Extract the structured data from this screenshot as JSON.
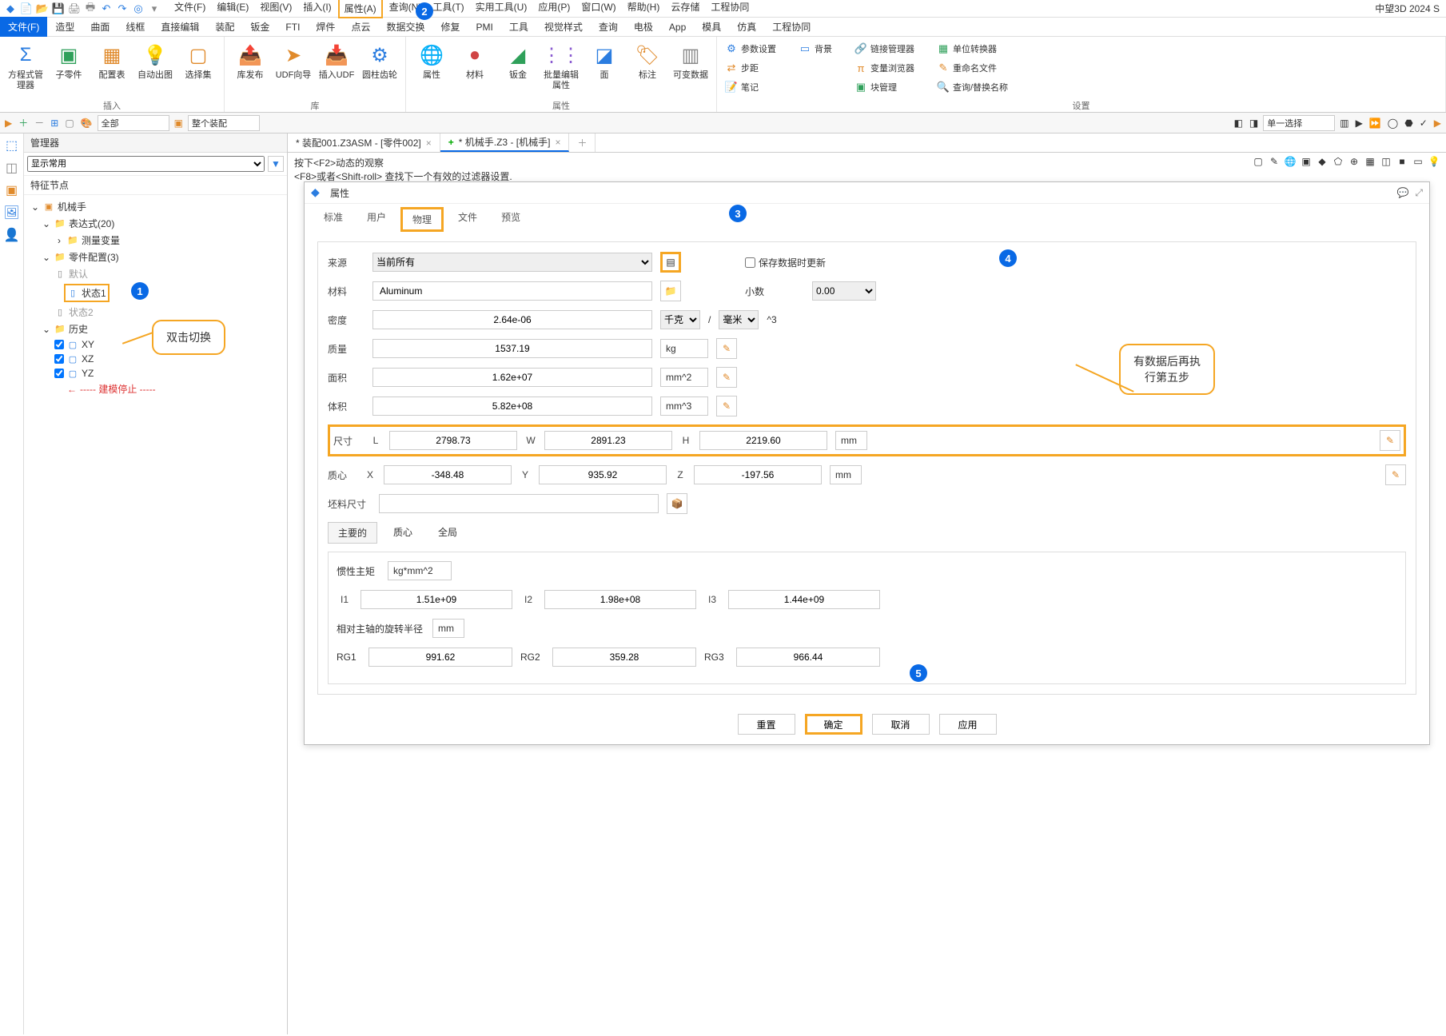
{
  "brand": "中望3D 2024 S",
  "menus": [
    "文件(F)",
    "编辑(E)",
    "视图(V)",
    "插入(I)",
    "属性(A)",
    "查询(N)",
    "工具(T)",
    "实用工具(U)",
    "应用(P)",
    "窗口(W)",
    "帮助(H)",
    "云存储",
    "工程协同"
  ],
  "menu_boxed_index": 4,
  "ribbon_tabs": [
    "文件(F)",
    "造型",
    "曲面",
    "线框",
    "直接编辑",
    "装配",
    "钣金",
    "FTI",
    "焊件",
    "点云",
    "数据交换",
    "修复",
    "PMI",
    "工具",
    "视觉样式",
    "查询",
    "电极",
    "App",
    "模具",
    "仿真",
    "工程协同"
  ],
  "ribbon_active": "文件(F)",
  "ribbon_groups": {
    "g1": {
      "label": "插入",
      "btns": [
        "方程式管理器",
        "子零件",
        "配置表",
        "自动出图",
        "选择集"
      ]
    },
    "g2": {
      "label": "库",
      "btns": [
        "库发布",
        "UDF向导",
        "插入UDF",
        "圆柱齿轮"
      ]
    },
    "g3": {
      "label": "属性",
      "btns": [
        "属性",
        "材料",
        "钣金",
        "批量编辑属性",
        "面",
        "标注",
        "可变数据"
      ]
    },
    "g4": {
      "label": "设置",
      "items": [
        "参数设置",
        "步距",
        "笔记",
        "背景",
        "链接管理器",
        "变量浏览器",
        "块管理",
        "单位转换器",
        "重命名文件",
        "查询/替换名称"
      ]
    }
  },
  "toolbar2": {
    "combo1": "全部",
    "combo2": "整个装配",
    "combo3": "单一选择"
  },
  "manager": {
    "title": "管理器",
    "display": "显示常用",
    "feature_label": "特征节点",
    "tree": {
      "root": "机械手",
      "expr": "表达式(20)",
      "measure": "测量变量",
      "partcfg": "零件配置(3)",
      "default": "默认",
      "state1": "状态1",
      "state2": "状态2",
      "history": "历史",
      "xy": "XY",
      "xz": "XZ",
      "yz": "YZ",
      "stop": "----- 建模停止 -----"
    }
  },
  "doc_tabs": {
    "tab1": "* 装配001.Z3ASM - [零件002]",
    "tab2": "* 机械手.Z3 - [机械手]",
    "plus": "+"
  },
  "hints": {
    "l1": "按下<F2>动态的观察",
    "l2": "<F8>或者<Shift-roll> 查找下一个有效的过滤器设置."
  },
  "dialog": {
    "title": "属性",
    "tabs": [
      "标准",
      "用户",
      "物理",
      "文件",
      "预览"
    ],
    "labels": {
      "source": "来源",
      "material": "材料",
      "density": "密度",
      "mass": "质量",
      "area": "面积",
      "volume": "体积",
      "size": "尺寸",
      "centroid": "质心",
      "blank": "坯料尺寸",
      "save_update": "保存数据时更新",
      "decimal": "小数",
      "inertia_unit_lbl": "惯性主矩",
      "rot_radius": "相对主轴的旋转半径"
    },
    "source_value": "当前所有",
    "material_value": "Aluminum",
    "density_value": "2.64e-06",
    "density_unit1": "千克",
    "density_slash": "/",
    "density_unit2": "毫米",
    "density_exp": "^3",
    "decimal_value": "0.00",
    "mass": {
      "v": "1537.19",
      "u": "kg"
    },
    "area": {
      "v": "1.62e+07",
      "u": "mm^2"
    },
    "volume": {
      "v": "5.82e+08",
      "u": "mm^3"
    },
    "size": {
      "L": "2798.73",
      "W": "2891.23",
      "H": "2219.60",
      "u": "mm"
    },
    "centroid": {
      "X": "-348.48",
      "Y": "935.92",
      "Z": "-197.56",
      "u": "mm"
    },
    "inertia_tabs": [
      "主要的",
      "质心",
      "全局"
    ],
    "inertia_unit": "kg*mm^2",
    "I1": "1.51e+09",
    "I2": "1.98e+08",
    "I3": "1.44e+09",
    "rot_unit": "mm",
    "RG1": "991.62",
    "RG2": "359.28",
    "RG3": "966.44",
    "actions": {
      "reset": "重置",
      "ok": "确定",
      "cancel": "取消",
      "apply": "应用"
    }
  },
  "callouts": {
    "c1": "双击切换",
    "c2a": "有数据后再执",
    "c2b": "行第五步"
  },
  "abbr": {
    "L": "L",
    "W": "W",
    "H": "H",
    "X": "X",
    "Y": "Y",
    "Z": "Z",
    "I1": "I1",
    "I2": "I2",
    "I3": "I3",
    "RG1": "RG1",
    "RG2": "RG2",
    "RG3": "RG3"
  }
}
